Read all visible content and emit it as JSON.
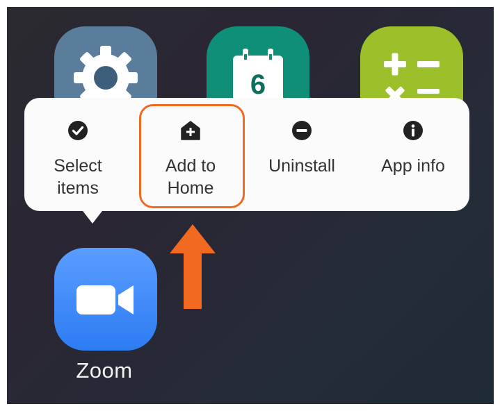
{
  "apps": {
    "settings": {
      "icon": "gear-icon"
    },
    "calendar": {
      "icon": "calendar-icon",
      "day": "6"
    },
    "calculator": {
      "icon": "calculator-icon"
    },
    "zoom": {
      "icon": "video-camera-icon",
      "label": "Zoom"
    }
  },
  "context_menu": {
    "items": [
      {
        "icon": "checkmark-circle-icon",
        "line1": "Select",
        "line2": "items"
      },
      {
        "icon": "home-add-icon",
        "line1": "Add to",
        "line2": "Home"
      },
      {
        "icon": "minus-circle-icon",
        "line1": "Uninstall",
        "line2": ""
      },
      {
        "icon": "info-circle-icon",
        "line1": "App info",
        "line2": ""
      }
    ],
    "highlighted_item": "Add to Home"
  },
  "annotation": {
    "highlight_color": "#f26a22",
    "arrow_icon": "up-arrow-icon"
  },
  "colors": {
    "settings_bg": "#5b7d9c",
    "calendar_bg": "#0f8f78",
    "calculator_bg": "#9bc02a",
    "zoom_bg": "#2d7cf2",
    "popup_bg": "#fbfbfb"
  }
}
